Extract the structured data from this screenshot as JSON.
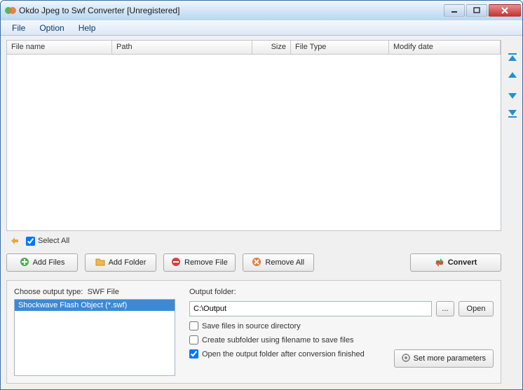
{
  "title": "Okdo Jpeg to Swf Converter [Unregistered]",
  "menu": {
    "file": "File",
    "option": "Option",
    "help": "Help"
  },
  "columns": {
    "name": "File name",
    "path": "Path",
    "size": "Size",
    "type": "File Type",
    "date": "Modify date"
  },
  "selectAll": "Select All",
  "actions": {
    "addFiles": "Add Files",
    "addFolder": "Add Folder",
    "removeFile": "Remove File",
    "removeAll": "Remove All",
    "convert": "Convert"
  },
  "outputType": {
    "label": "Choose output type:",
    "value": "SWF File",
    "option": "Shockwave Flash Object (*.swf)"
  },
  "outputFolder": {
    "label": "Output folder:",
    "value": "C:\\Output",
    "browse": "...",
    "open": "Open"
  },
  "options": {
    "saveSource": "Save files in source directory",
    "createSubfolder": "Create subfolder using filename to save files",
    "openAfter": "Open the output folder after conversion finished"
  },
  "moreParams": "Set more parameters"
}
